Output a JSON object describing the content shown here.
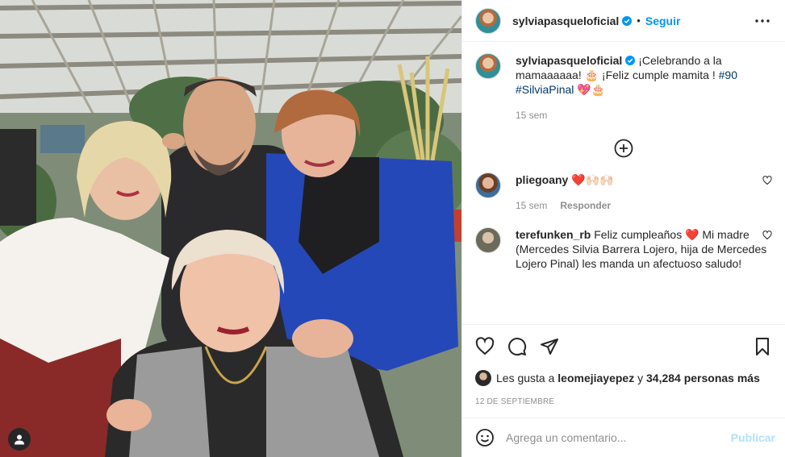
{
  "post": {
    "author": "sylviapasqueloficial",
    "follow_label": "Seguir",
    "separator": "•"
  },
  "caption": {
    "author": "sylviapasqueloficial",
    "text": "¡Celebrando a la mamaaaaaa! 🎂 ¡Feliz cumple mamita ! ",
    "hashtag_1": "#90",
    "hashtag_2": "#SilviaPinal",
    "emoji": "💖🎂",
    "time": "15 sem"
  },
  "comments": [
    {
      "author": "pliegoany",
      "text": "❤️🙌🏻🙌🏻",
      "time": "15 sem",
      "reply_label": "Responder"
    },
    {
      "author": "terefunken_rb",
      "text": "Feliz cumpleaños ❤️ Mi madre (Mercedes Silvia Barrera Lojero, hija de Mercedes Lojero Pinal) les manda un afectuoso saludo!"
    }
  ],
  "likes": {
    "prefix": "Les gusta a",
    "user": "leomejiayepez",
    "middle": "y",
    "count": "34,284 personas más"
  },
  "date": "12 DE SEPTIEMBRE",
  "add_comment": {
    "placeholder": "Agrega un comentario...",
    "publish_label": "Publicar"
  },
  "icons": {
    "verified": "verified-badge-icon",
    "more": "more-options-icon",
    "load_more": "plus-circle-icon",
    "like": "heart-icon",
    "comment": "comment-icon",
    "share": "paper-plane-icon",
    "save": "bookmark-icon",
    "emoji": "emoji-icon",
    "user_tag": "user-tag-icon"
  },
  "colors": {
    "link": "#0095f6",
    "hashtag": "#00376b",
    "muted": "#8e8e8e",
    "publish_disabled": "#b3dffc"
  }
}
